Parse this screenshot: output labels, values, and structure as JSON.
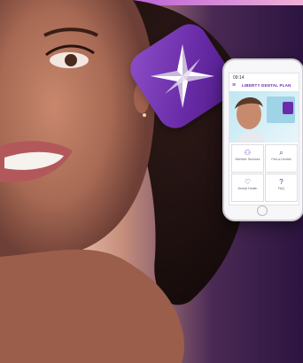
{
  "phone": {
    "status_time": "09:14",
    "app_title": "LIBERTY DENTAL PLAN",
    "tiles": [
      {
        "icon": "members-icon",
        "glyph": "⚇",
        "label": "Member Services"
      },
      {
        "icon": "search-icon",
        "glyph": "⌕",
        "label": "Find a Dentist"
      },
      {
        "icon": "tooth-icon",
        "glyph": "♡",
        "label": "Dental Health"
      },
      {
        "icon": "faq-icon",
        "glyph": "?",
        "label": "FAQ"
      }
    ]
  },
  "colors": {
    "brand_purple": "#6a2ca8",
    "accent_pink": "#f39ac9"
  }
}
